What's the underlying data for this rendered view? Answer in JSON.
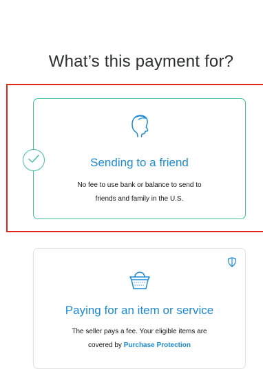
{
  "page": {
    "title": "What’s this payment for?"
  },
  "options": {
    "friend": {
      "title": "Sending to a friend",
      "description_line1": "No fee to use bank or balance to send to",
      "description_line2": "friends and family in the U.S.",
      "icon": "person-silhouette-icon",
      "selected": true,
      "check_icon": "checkmark-icon"
    },
    "service": {
      "title": "Paying for an item or service",
      "description_line1": "The seller pays a fee. Your eligible items are",
      "description_prefix": "covered by ",
      "link_label": "Purchase Protection",
      "icon": "shopping-basket-icon",
      "badge_icon": "shield-icon",
      "selected": false
    }
  },
  "colors": {
    "accent_teal": "#40c0a0",
    "link_blue": "#1b8ad3",
    "highlight_red": "#e1261c",
    "text_dark": "#2c2e2f"
  }
}
